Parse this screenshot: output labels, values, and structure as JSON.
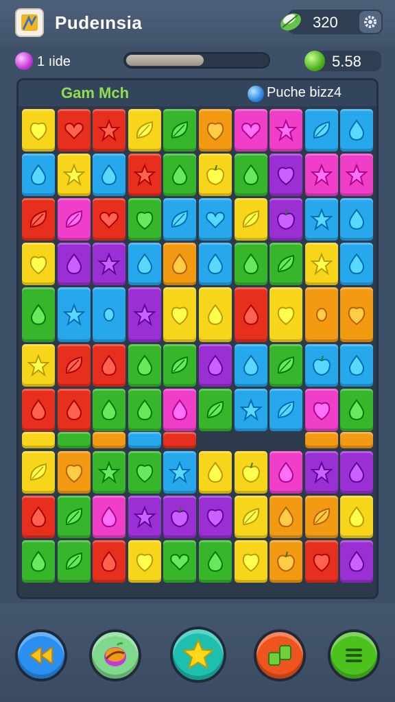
{
  "header": {
    "title": "Pudeınsia",
    "coins": "320"
  },
  "stats": {
    "gems_label": "1 ıide",
    "progress": 0.55,
    "score": "5.58"
  },
  "board": {
    "title": "Gam Mch",
    "puzzle_label": "Puche bizz4",
    "colors": {
      "yellow": "#f7d51b",
      "red": "#e6301d",
      "pink": "#ef3ec8",
      "green": "#37b62b",
      "orange": "#f39a13",
      "blue": "#27a7ec",
      "purple": "#9a2fd4",
      "lime": "#8ad42f"
    }
  },
  "buttons": {
    "back": {
      "color": "#2a8ff0"
    },
    "booster": {
      "color": "#7fd88b"
    },
    "star": {
      "color": "#1fbfb0"
    },
    "shuffle": {
      "color": "#f0541e"
    },
    "menu": {
      "color": "#4cc21f"
    }
  }
}
